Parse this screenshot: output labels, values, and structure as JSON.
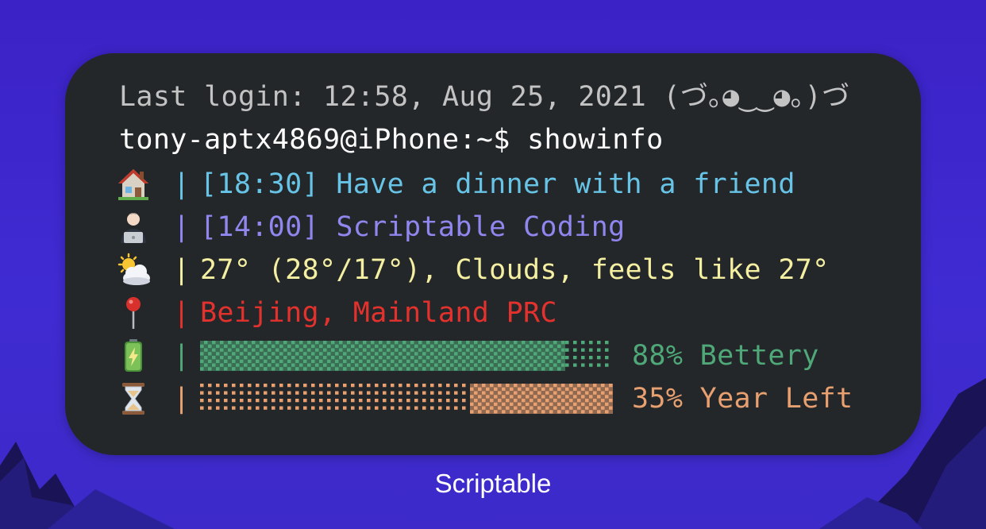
{
  "widget": {
    "login_line": "Last login: 12:58, Aug 25, 2021 (づ｡◕‿‿◕｡)づ",
    "prompt_line": "tony-aptx4869@iPhone:~$ showinfo",
    "rows": [
      {
        "icon": "house-icon",
        "separator": "|",
        "text": "[18:30] Have a dinner with a friend",
        "color": "#67c4e6"
      },
      {
        "icon": "technologist-icon",
        "separator": "|",
        "text": "[14:00] Scriptable Coding",
        "color": "#8f86ee"
      },
      {
        "icon": "sun-behind-cloud-icon",
        "separator": "|",
        "text": "27° (28°/17°), Clouds, feels like 27°",
        "color": "#f4efa1"
      },
      {
        "icon": "pin-icon",
        "separator": "|",
        "text": "Beijing, Mainland PRC",
        "color": "#e3322d"
      },
      {
        "icon": "battery-icon",
        "separator": "|",
        "text": "88% Bettery",
        "color": "#4fa878",
        "progress": 0.88
      },
      {
        "icon": "hourglass-icon",
        "separator": "|",
        "text": "35% Year Left",
        "color": "#e8a070",
        "progress": 0.35
      }
    ]
  },
  "app_label": "Scriptable",
  "colors": {
    "background": "#3d28cc",
    "widget_bg": "#24272a",
    "login_text": "#c3c3c3",
    "prompt_text": "#ffffff"
  }
}
